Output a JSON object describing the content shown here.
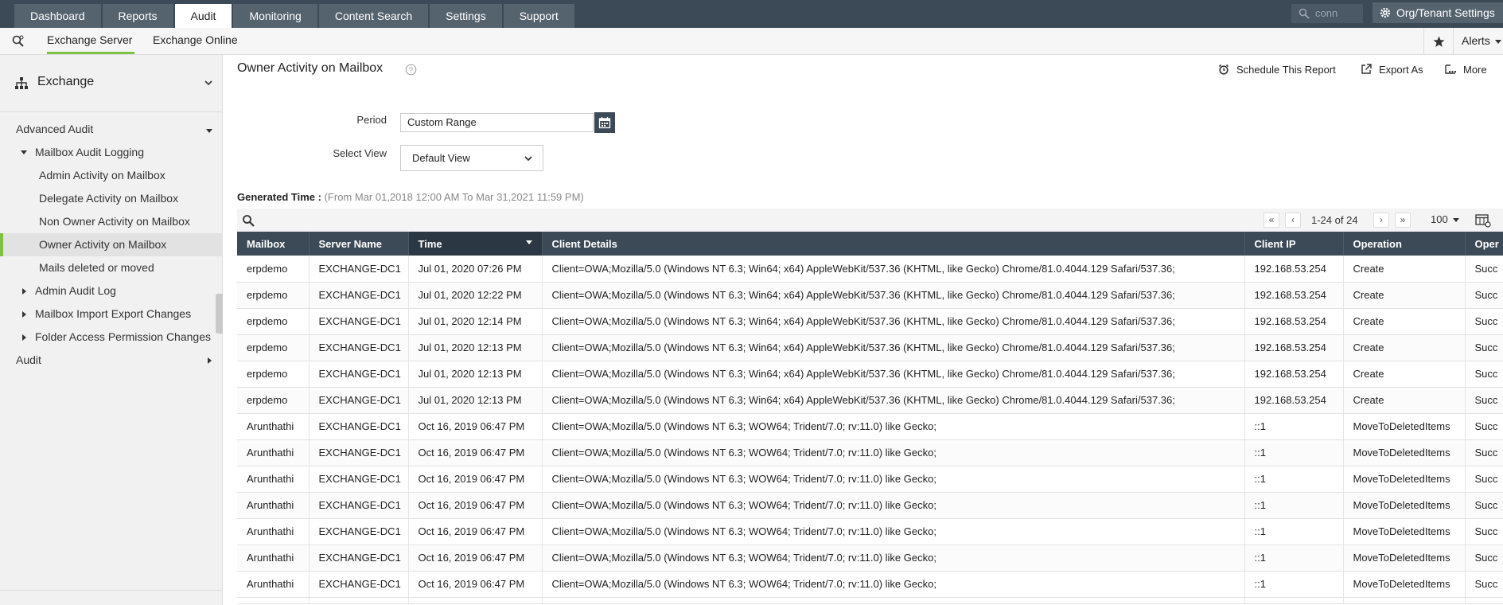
{
  "top_nav": {
    "tabs": [
      {
        "label": "Dashboard",
        "active": false
      },
      {
        "label": "Reports",
        "active": false
      },
      {
        "label": "Audit",
        "active": true
      },
      {
        "label": "Monitoring",
        "active": false
      },
      {
        "label": "Content Search",
        "active": false
      },
      {
        "label": "Settings",
        "active": false
      },
      {
        "label": "Support",
        "active": false
      }
    ],
    "search_value": "conn",
    "org_settings_label": "Org/Tenant Settings"
  },
  "sub_nav": {
    "tabs": [
      {
        "label": "Exchange Server",
        "active": true
      },
      {
        "label": "Exchange Online",
        "active": false
      }
    ],
    "alerts_label": "Alerts"
  },
  "sidebar": {
    "header": "Exchange",
    "items": [
      {
        "label": "Advanced Audit"
      },
      {
        "label": "Mailbox Audit Logging"
      },
      {
        "label": "Admin Activity on Mailbox"
      },
      {
        "label": "Delegate Activity on Mailbox"
      },
      {
        "label": "Non Owner Activity on Mailbox"
      },
      {
        "label": "Owner Activity on Mailbox",
        "selected": true
      },
      {
        "label": "Mails deleted or moved"
      },
      {
        "label": "Admin Audit Log"
      },
      {
        "label": "Mailbox Import Export Changes"
      },
      {
        "label": "Folder Access Permission Changes"
      },
      {
        "label": "Audit"
      }
    ]
  },
  "report": {
    "title": "Owner Activity on Mailbox",
    "actions": {
      "schedule": "Schedule This Report",
      "export": "Export As",
      "more": "More"
    },
    "period_label": "Period",
    "period_value": "Custom Range",
    "view_label": "Select View",
    "view_value": "Default View",
    "generated_label": "Generated Time :",
    "generated_range": "(From Mar 01,2018 12:00 AM To Mar 31,2021 11:59 PM)",
    "pagination": "1-24 of 24",
    "per_page": "100",
    "colors": {
      "header_bg": "#3c4a57",
      "accent": "#7dc243"
    }
  },
  "table": {
    "columns": [
      "Mailbox",
      "Server Name",
      "Time",
      "Client Details",
      "Client IP",
      "Operation",
      "Oper"
    ],
    "rows": [
      [
        "erpdemo",
        "EXCHANGE-DC1",
        "Jul 01, 2020 07:26 PM",
        "Client=OWA;Mozilla/5.0 (Windows NT 6.3; Win64; x64) AppleWebKit/537.36 (KHTML, like Gecko) Chrome/81.0.4044.129 Safari/537.36;",
        "192.168.53.254",
        "Create",
        "Succ"
      ],
      [
        "erpdemo",
        "EXCHANGE-DC1",
        "Jul 01, 2020 12:22 PM",
        "Client=OWA;Mozilla/5.0 (Windows NT 6.3; Win64; x64) AppleWebKit/537.36 (KHTML, like Gecko) Chrome/81.0.4044.129 Safari/537.36;",
        "192.168.53.254",
        "Create",
        "Succ"
      ],
      [
        "erpdemo",
        "EXCHANGE-DC1",
        "Jul 01, 2020 12:14 PM",
        "Client=OWA;Mozilla/5.0 (Windows NT 6.3; Win64; x64) AppleWebKit/537.36 (KHTML, like Gecko) Chrome/81.0.4044.129 Safari/537.36;",
        "192.168.53.254",
        "Create",
        "Succ"
      ],
      [
        "erpdemo",
        "EXCHANGE-DC1",
        "Jul 01, 2020 12:13 PM",
        "Client=OWA;Mozilla/5.0 (Windows NT 6.3; Win64; x64) AppleWebKit/537.36 (KHTML, like Gecko) Chrome/81.0.4044.129 Safari/537.36;",
        "192.168.53.254",
        "Create",
        "Succ"
      ],
      [
        "erpdemo",
        "EXCHANGE-DC1",
        "Jul 01, 2020 12:13 PM",
        "Client=OWA;Mozilla/5.0 (Windows NT 6.3; Win64; x64) AppleWebKit/537.36 (KHTML, like Gecko) Chrome/81.0.4044.129 Safari/537.36;",
        "192.168.53.254",
        "Create",
        "Succ"
      ],
      [
        "erpdemo",
        "EXCHANGE-DC1",
        "Jul 01, 2020 12:13 PM",
        "Client=OWA;Mozilla/5.0 (Windows NT 6.3; Win64; x64) AppleWebKit/537.36 (KHTML, like Gecko) Chrome/81.0.4044.129 Safari/537.36;",
        "192.168.53.254",
        "Create",
        "Succ"
      ],
      [
        "Arunthathi",
        "EXCHANGE-DC1",
        "Oct 16, 2019 06:47 PM",
        "Client=OWA;Mozilla/5.0 (Windows NT 6.3; WOW64; Trident/7.0; rv:11.0) like Gecko;",
        "::1",
        "MoveToDeletedItems",
        "Succ"
      ],
      [
        "Arunthathi",
        "EXCHANGE-DC1",
        "Oct 16, 2019 06:47 PM",
        "Client=OWA;Mozilla/5.0 (Windows NT 6.3; WOW64; Trident/7.0; rv:11.0) like Gecko;",
        "::1",
        "MoveToDeletedItems",
        "Succ"
      ],
      [
        "Arunthathi",
        "EXCHANGE-DC1",
        "Oct 16, 2019 06:47 PM",
        "Client=OWA;Mozilla/5.0 (Windows NT 6.3; WOW64; Trident/7.0; rv:11.0) like Gecko;",
        "::1",
        "MoveToDeletedItems",
        "Succ"
      ],
      [
        "Arunthathi",
        "EXCHANGE-DC1",
        "Oct 16, 2019 06:47 PM",
        "Client=OWA;Mozilla/5.0 (Windows NT 6.3; WOW64; Trident/7.0; rv:11.0) like Gecko;",
        "::1",
        "MoveToDeletedItems",
        "Succ"
      ],
      [
        "Arunthathi",
        "EXCHANGE-DC1",
        "Oct 16, 2019 06:47 PM",
        "Client=OWA;Mozilla/5.0 (Windows NT 6.3; WOW64; Trident/7.0; rv:11.0) like Gecko;",
        "::1",
        "MoveToDeletedItems",
        "Succ"
      ],
      [
        "Arunthathi",
        "EXCHANGE-DC1",
        "Oct 16, 2019 06:47 PM",
        "Client=OWA;Mozilla/5.0 (Windows NT 6.3; WOW64; Trident/7.0; rv:11.0) like Gecko;",
        "::1",
        "MoveToDeletedItems",
        "Succ"
      ],
      [
        "Arunthathi",
        "EXCHANGE-DC1",
        "Oct 16, 2019 06:47 PM",
        "Client=OWA;Mozilla/5.0 (Windows NT 6.3; WOW64; Trident/7.0; rv:11.0) like Gecko;",
        "::1",
        "MoveToDeletedItems",
        "Succ"
      ]
    ]
  }
}
